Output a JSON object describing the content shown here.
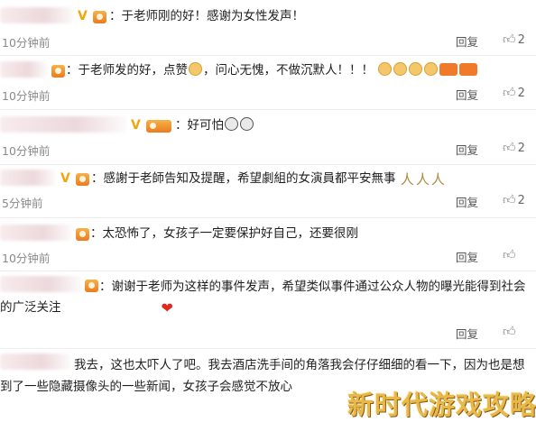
{
  "comments": [
    {
      "text": "：于老师刚的好！感谢为女性发声！",
      "time": "10分钟前",
      "reply": "回复",
      "likes": "2"
    },
    {
      "text": "：于老师发的好，点赞",
      "text_b": "，问心无愧，不做沉默人！！！",
      "time": "10分钟前",
      "reply": "回复",
      "likes": "2"
    },
    {
      "text": "：好可怕",
      "time": "10分钟前",
      "reply": "回复",
      "likes": "2"
    },
    {
      "text": "：感謝于老師告知及提醒，希望劇組的女演員都平安無事",
      "time": "5分钟前",
      "reply": "回复",
      "likes": "2"
    },
    {
      "text": "：太恐怖了，女孩子一定要保护好自己，还要很刚",
      "time": "10分钟前",
      "reply": "回复",
      "likes": ""
    },
    {
      "text": "：谢谢于老师为这样的事件发声，希望类似事件通过公众人物的曝光能得到社会的广泛关注",
      "time": "10分钟前",
      "reply": "回复",
      "likes": ""
    },
    {
      "text": "我去，这也太吓人了吧。我去酒店洗手间的角落我会仔仔细细的看一下，因为也是想到了一些隐藏摄像头的一些新闻，女孩子会感觉不放心",
      "time": "",
      "reply": "",
      "likes": ""
    }
  ],
  "watermark": "新时代游戏攻略",
  "icons": {
    "like": "thumb-up-icon",
    "verified": "v-badge-icon",
    "member": "member-badge-icon"
  },
  "colors": {
    "verified": "#f2a60c",
    "time": "#8a8a8a",
    "heart": "#e0281e",
    "watermark": "#e8b94a"
  }
}
